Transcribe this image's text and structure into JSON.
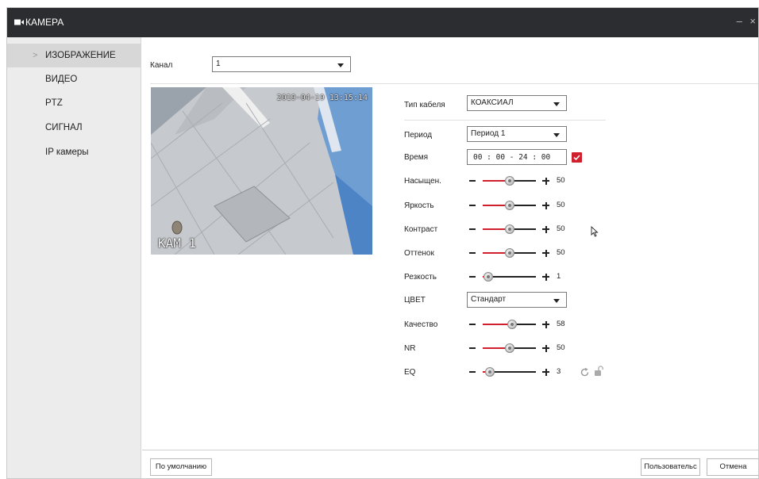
{
  "window": {
    "title": "КАМЕРА",
    "controls": "– ×"
  },
  "sidebar": {
    "items": [
      {
        "label": "ИЗОБРАЖЕНИЕ",
        "active": true,
        "arrow": ">"
      },
      {
        "label": "ВИДЕО"
      },
      {
        "label": "PTZ"
      },
      {
        "label": "СИГНАЛ"
      },
      {
        "label": "IP камеры"
      }
    ]
  },
  "channel": {
    "label": "Канал",
    "value": "1"
  },
  "preview": {
    "timestamp": "2019-04-19 13:15:14",
    "camera_name": "КАМ 1"
  },
  "settings": {
    "cable_type": {
      "label": "Тип кабеля",
      "value": "КОАКСИАЛ"
    },
    "period": {
      "label": "Период",
      "value": "Период 1"
    },
    "time": {
      "label": "Время",
      "value": "00 : 00 - 24 : 00",
      "checked": true
    },
    "saturation": {
      "label": "Насыщен.",
      "value": "50",
      "level": 0.5
    },
    "brightness": {
      "label": "Яркость",
      "value": "50",
      "level": 0.5
    },
    "contrast": {
      "label": "Контраст",
      "value": "50",
      "level": 0.5
    },
    "hue": {
      "label": "Оттенок",
      "value": "50",
      "level": 0.5
    },
    "sharpness": {
      "label": "Резкость",
      "value": "1",
      "level": 0.1
    },
    "color": {
      "label": "ЦВЕТ",
      "value": "Стандарт"
    },
    "quality": {
      "label": "Качество",
      "value": "58",
      "level": 0.55
    },
    "nr": {
      "label": "NR",
      "value": "50",
      "level": 0.5
    },
    "eq": {
      "label": "EQ",
      "value": "3",
      "level": 0.14
    }
  },
  "buttons": {
    "default": "По умолчанию",
    "custom": "Пользовательс",
    "cancel": "Отмена"
  },
  "colors": {
    "accent": "#d0202e",
    "titlebar": "#2b2d30",
    "sidebar": "#ececec",
    "sidebar_active": "#d7d7d7"
  },
  "icons": [
    "camera-icon",
    "refresh-icon",
    "lock-icon",
    "mouse-cursor-icon"
  ]
}
